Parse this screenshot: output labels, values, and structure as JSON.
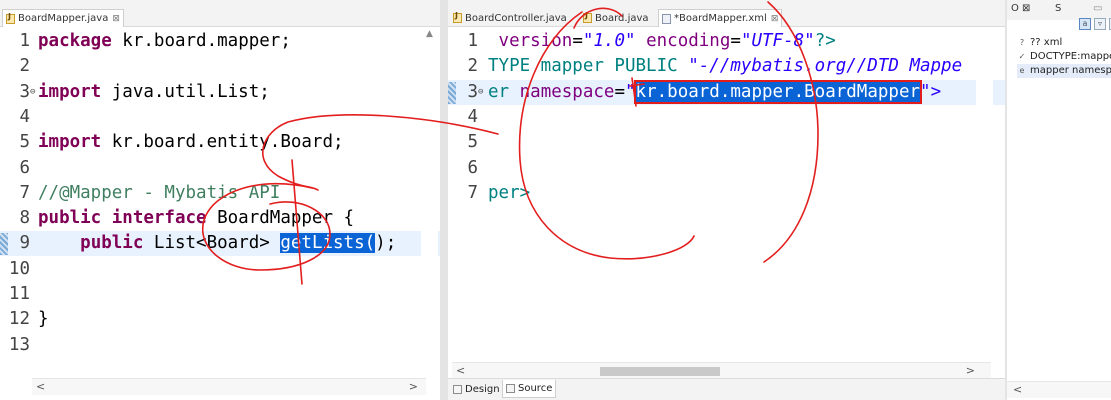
{
  "left_editor": {
    "tab_label": "BoardMapper.java",
    "tab_close": "⊠",
    "lines": [
      {
        "num": "1",
        "segments": [
          {
            "t": "package",
            "c": "kw"
          },
          {
            "t": " kr.board.mapper;",
            "c": ""
          }
        ]
      },
      {
        "num": "2",
        "segments": []
      },
      {
        "num": "3",
        "fold": "⊖",
        "segments": [
          {
            "t": "import",
            "c": "kw"
          },
          {
            "t": " java.util.List;",
            "c": ""
          }
        ]
      },
      {
        "num": "4",
        "segments": []
      },
      {
        "num": "5",
        "segments": [
          {
            "t": "import",
            "c": "kw"
          },
          {
            "t": " kr.board.entity.Board;",
            "c": ""
          }
        ]
      },
      {
        "num": "6",
        "segments": []
      },
      {
        "num": "7",
        "segments": [
          {
            "t": "//@Mapper - Mybatis API",
            "c": "cm"
          }
        ]
      },
      {
        "num": "8",
        "segments": [
          {
            "t": "public interface",
            "c": "kw"
          },
          {
            "t": " BoardMapper {",
            "c": ""
          }
        ]
      },
      {
        "num": "9",
        "current": true,
        "segments": [
          {
            "t": "    ",
            "c": ""
          },
          {
            "t": "public",
            "c": "kw"
          },
          {
            "t": " List<Board> ",
            "c": ""
          },
          {
            "t": "getLists(",
            "c": "sel"
          },
          {
            "t": ");",
            "c": ""
          }
        ]
      },
      {
        "num": "10",
        "segments": []
      },
      {
        "num": "11",
        "segments": []
      },
      {
        "num": "12",
        "segments": [
          {
            "t": "}",
            "c": ""
          }
        ]
      },
      {
        "num": "13",
        "segments": []
      }
    ]
  },
  "mid_editor": {
    "tabs": [
      {
        "label": "BoardController.java",
        "icon": "java"
      },
      {
        "label": "Board.java",
        "icon": "java"
      },
      {
        "label": "*BoardMapper.xml",
        "icon": "xml",
        "active": true,
        "close": "⊠"
      }
    ],
    "lines": [
      {
        "num": "1",
        "segments": [
          {
            "t": " ",
            "c": ""
          },
          {
            "t": "version",
            "c": "attr"
          },
          {
            "t": "=",
            "c": ""
          },
          {
            "t": "\"1.0\"",
            "c": "str"
          },
          {
            "t": " ",
            "c": ""
          },
          {
            "t": "encoding",
            "c": "attr"
          },
          {
            "t": "=",
            "c": ""
          },
          {
            "t": "\"UTF-8\"",
            "c": "str"
          },
          {
            "t": "?>",
            "c": "tagc"
          }
        ]
      },
      {
        "num": "2",
        "segments": [
          {
            "t": "TYPE mapper PUBLIC ",
            "c": "tagc"
          },
          {
            "t": "\"-//mybatis.org//DTD Mappe",
            "c": "str"
          }
        ]
      },
      {
        "num": "3",
        "fold": "⊖",
        "current": true,
        "segments": [
          {
            "t": "er",
            "c": "tagc"
          },
          {
            "t": " ",
            "c": ""
          },
          {
            "t": "namespace",
            "c": "attr"
          },
          {
            "t": "=",
            "c": ""
          },
          {
            "t": "\"",
            "c": "str"
          },
          {
            "t": "kr.board.mapper.BoardMapper",
            "c": "selbox"
          },
          {
            "t": "\">",
            "c": "str"
          }
        ]
      },
      {
        "num": "4",
        "segments": []
      },
      {
        "num": "5",
        "segments": []
      },
      {
        "num": "6",
        "segments": []
      },
      {
        "num": "7",
        "segments": [
          {
            "t": "per>",
            "c": "tagc"
          }
        ]
      }
    ],
    "bottom_tabs": [
      {
        "label": "Design",
        "active": false
      },
      {
        "label": "Source",
        "active": true
      }
    ]
  },
  "outline": {
    "tabs": [
      {
        "label": "O ⊠"
      },
      {
        "label": "S"
      }
    ],
    "items": [
      {
        "icon": "?",
        "label": "?? xml"
      },
      {
        "icon": "✓",
        "label": "DOCTYPE:mapper"
      },
      {
        "icon": "e",
        "label": "mapper namespace",
        "selected": true
      }
    ]
  }
}
